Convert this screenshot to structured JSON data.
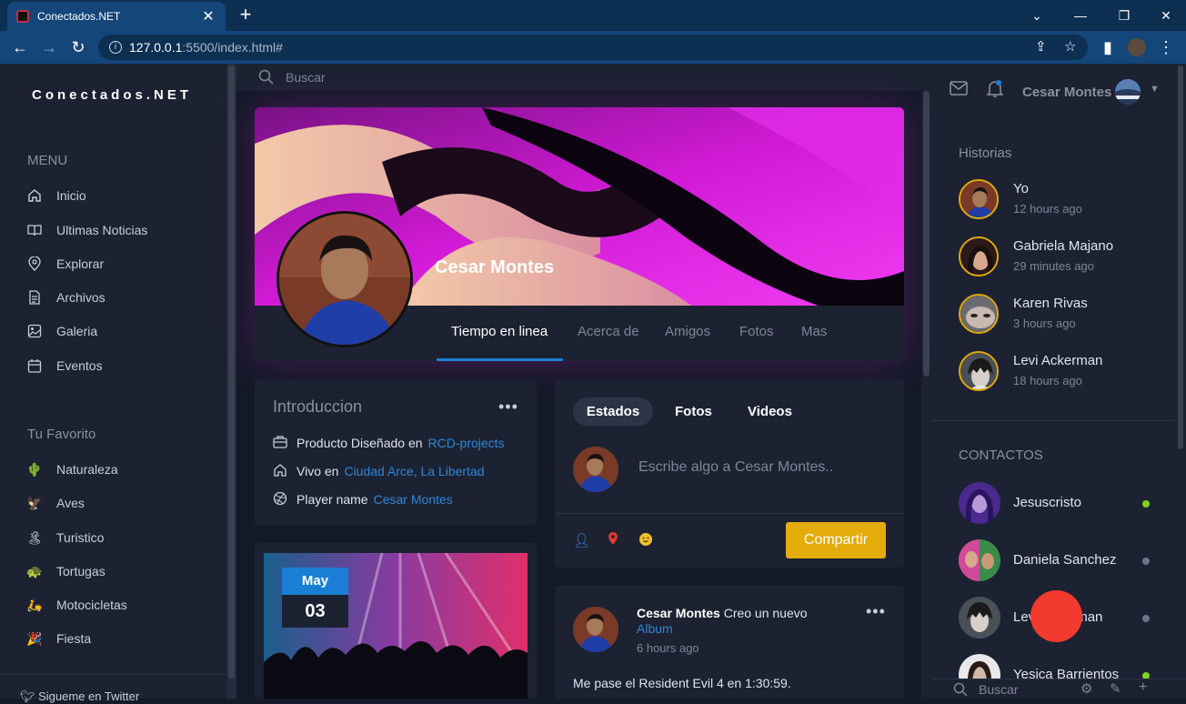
{
  "browser": {
    "tab_title": "Conectados.NET",
    "url_host": "127.0.0.1",
    "url_rest": ":5500/index.html#"
  },
  "sidebar": {
    "logo": "Conectados.NET",
    "menu_title": "MENU",
    "menu_items": [
      {
        "label": "Inicio",
        "icon": "home-icon"
      },
      {
        "label": "Ultimas Noticias",
        "icon": "book-icon"
      },
      {
        "label": "Explorar",
        "icon": "location-pin-icon"
      },
      {
        "label": "Archivos",
        "icon": "file-icon"
      },
      {
        "label": "Galeria",
        "icon": "image-icon"
      },
      {
        "label": "Eventos",
        "icon": "calendar-icon"
      }
    ],
    "fav_title": "Tu Favorito",
    "fav_items": [
      {
        "label": "Naturaleza",
        "icon": "🌵"
      },
      {
        "label": "Aves",
        "icon": "🦅"
      },
      {
        "label": "Turistico",
        "icon": "🏝"
      },
      {
        "label": "Tortugas",
        "icon": "🐢"
      },
      {
        "label": "Motocicletas",
        "icon": "🛵"
      },
      {
        "label": "Fiesta",
        "icon": "🎉"
      }
    ],
    "footer": "Sigueme en Twitter"
  },
  "search": {
    "placeholder": "Buscar"
  },
  "profile": {
    "name": "Cesar Montes",
    "tabs": [
      "Tiempo en linea",
      "Acerca de",
      "Amigos",
      "Fotos",
      "Mas"
    ]
  },
  "intro": {
    "title": "Introduccion",
    "more": "•••",
    "rows": [
      {
        "label": "Producto Diseñado en",
        "link": "RCD-projects",
        "icon": "briefcase-icon"
      },
      {
        "label": "Vivo en",
        "link": "Ciudad Arce, La Libertad",
        "icon": "home-icon"
      },
      {
        "label": "Player name",
        "link": "Cesar Montes",
        "icon": "dribbble-icon"
      }
    ]
  },
  "composer": {
    "tabs": [
      "Estados",
      "Fotos",
      "Videos"
    ],
    "placeholder": "Escribe algo a Cesar Montes..",
    "share_label": "Compartir"
  },
  "post": {
    "author": "Cesar Montes",
    "action": " Creo un nuevo",
    "link": "Album",
    "time": "6 hours ago",
    "text": "Me pase el Resident Evil 4 en 1:30:59.",
    "more": "•••"
  },
  "event": {
    "month": "May",
    "day": "03"
  },
  "right": {
    "username": "Cesar Montes",
    "stories_title": "Historias",
    "stories": [
      {
        "name": "Yo",
        "time": "12 hours ago"
      },
      {
        "name": "Gabriela Majano",
        "time": "29 minutes ago"
      },
      {
        "name": "Karen Rivas",
        "time": "3 hours ago"
      },
      {
        "name": "Levi Ackerman",
        "time": "18 hours ago"
      }
    ],
    "contacts_title": "CONTACTOS",
    "contacts": [
      {
        "name": "Jesuscristo",
        "status": "online",
        "color": "#7ed321"
      },
      {
        "name": "Daniela Sanchez",
        "status": "offline",
        "color": "#6b7690"
      },
      {
        "name": "Levi Ackerman",
        "status": "offline",
        "color": "#6b7690"
      },
      {
        "name": "Yesica Barrientos",
        "status": "online",
        "color": "#7ed321"
      }
    ],
    "bottom_search": "Buscar"
  },
  "colors": {
    "accent": "#1a7fd4",
    "share": "#e3ac0a",
    "online": "#7ed321",
    "overlay_dot": "#f23a2e"
  }
}
